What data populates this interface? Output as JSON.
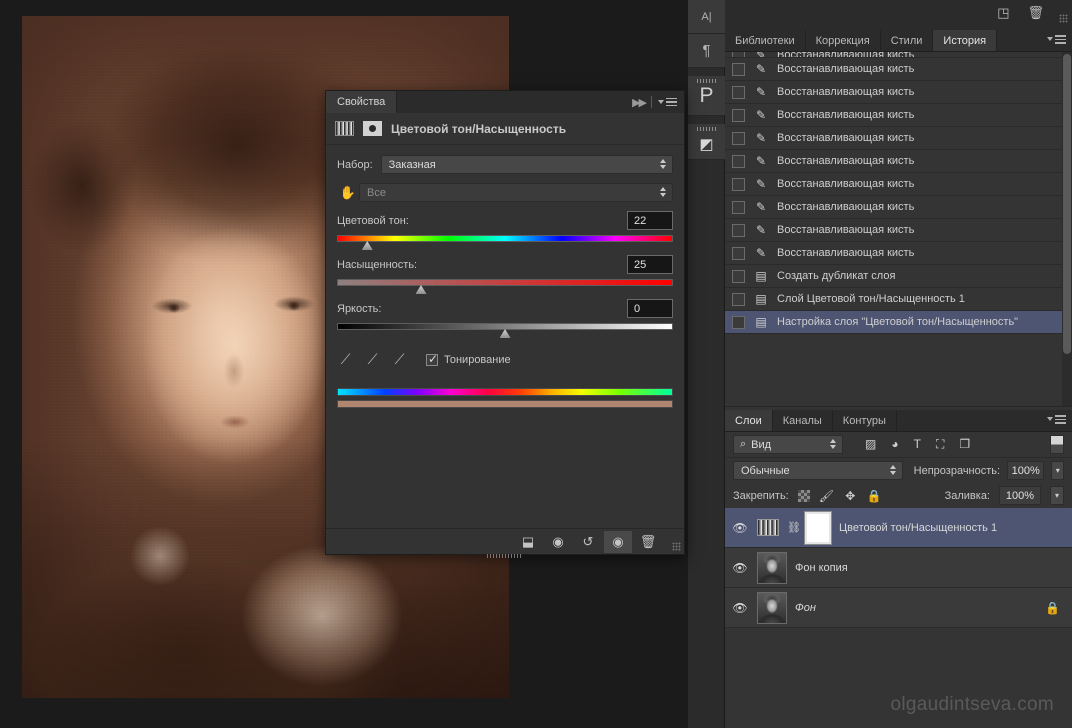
{
  "app": {
    "watermark": "olgaudintseva.com"
  },
  "tool_dock": {
    "items": [
      {
        "name": "character-panel-icon",
        "glyph": "A|"
      },
      {
        "name": "paragraph-panel-icon",
        "glyph": "¶"
      },
      {
        "name": "properties-panel-icon",
        "glyph": "P"
      },
      {
        "name": "adjustments-panel-icon",
        "glyph": "◩"
      }
    ]
  },
  "properties": {
    "tab_label": "Свойства",
    "title": "Цветовой тон/Насыщенность",
    "preset_label": "Набор:",
    "preset_value": "Заказная",
    "channel_value": "Все",
    "hue": {
      "label": "Цветовой тон:",
      "value": "22",
      "pos_pct": 9
    },
    "saturation": {
      "label": "Насыщенность:",
      "value": "25",
      "pos_pct": 25
    },
    "lightness": {
      "label": "Яркость:",
      "value": "0",
      "pos_pct": 50
    },
    "colorize_label": "Тонирование",
    "colorize_checked": true,
    "tint_color": "#b08670",
    "footer_icons": [
      {
        "name": "clip-to-layer-icon",
        "glyph": "⬓"
      },
      {
        "name": "view-previous-state-icon",
        "glyph": "◉"
      },
      {
        "name": "reset-icon",
        "glyph": "↺"
      },
      {
        "name": "toggle-visibility-icon",
        "glyph": "◉"
      },
      {
        "name": "delete-adjustment-icon",
        "glyph": "🗑"
      }
    ]
  },
  "right_dock": {
    "top_icons": [
      {
        "name": "new-item-icon",
        "glyph": "◳"
      },
      {
        "name": "delete-icon",
        "glyph": "🗑"
      }
    ],
    "tabs": [
      {
        "label": "Библиотеки",
        "active": false
      },
      {
        "label": "Коррекция",
        "active": false
      },
      {
        "label": "Стили",
        "active": false
      },
      {
        "label": "История",
        "active": true
      }
    ]
  },
  "history": {
    "rows": [
      {
        "label": "Восстанавливающая кисть",
        "icon": "healing-brush-icon",
        "glyph": "✎",
        "selected": false,
        "clipped": true
      },
      {
        "label": "Восстанавливающая кисть",
        "icon": "healing-brush-icon",
        "glyph": "✎",
        "selected": false
      },
      {
        "label": "Восстанавливающая кисть",
        "icon": "healing-brush-icon",
        "glyph": "✎",
        "selected": false
      },
      {
        "label": "Восстанавливающая кисть",
        "icon": "healing-brush-icon",
        "glyph": "✎",
        "selected": false
      },
      {
        "label": "Восстанавливающая кисть",
        "icon": "healing-brush-icon",
        "glyph": "✎",
        "selected": false
      },
      {
        "label": "Восстанавливающая кисть",
        "icon": "healing-brush-icon",
        "glyph": "✎",
        "selected": false
      },
      {
        "label": "Восстанавливающая кисть",
        "icon": "healing-brush-icon",
        "glyph": "✎",
        "selected": false
      },
      {
        "label": "Восстанавливающая кисть",
        "icon": "healing-brush-icon",
        "glyph": "✎",
        "selected": false
      },
      {
        "label": "Восстанавливающая кисть",
        "icon": "healing-brush-icon",
        "glyph": "✎",
        "selected": false
      },
      {
        "label": "Восстанавливающая кисть",
        "icon": "healing-brush-icon",
        "glyph": "✎",
        "selected": false
      },
      {
        "label": "Создать дубликат слоя",
        "icon": "document-icon",
        "glyph": "▤",
        "selected": false
      },
      {
        "label": "Слой Цветовой тон/Насыщенность 1",
        "icon": "document-icon",
        "glyph": "▤",
        "selected": false
      },
      {
        "label": "Настройка слоя \"Цветовой тон/Насыщенность\"",
        "icon": "document-icon",
        "glyph": "▤",
        "selected": true
      }
    ],
    "footer_icons": [
      {
        "name": "new-document-from-state-icon",
        "glyph": "⇥"
      },
      {
        "name": "new-snapshot-icon",
        "glyph": "▣"
      },
      {
        "name": "delete-state-icon",
        "glyph": "🗑"
      }
    ]
  },
  "layers": {
    "tabs": [
      {
        "label": "Слои",
        "active": true
      },
      {
        "label": "Каналы",
        "active": false
      },
      {
        "label": "Контуры",
        "active": false
      }
    ],
    "filter_value": "Вид",
    "filter_icons": [
      {
        "name": "filter-pixel-icon",
        "glyph": "▨"
      },
      {
        "name": "filter-adjustment-icon",
        "glyph": "◕"
      },
      {
        "name": "filter-type-icon",
        "glyph": "T"
      },
      {
        "name": "filter-shape-icon",
        "glyph": "⛶"
      },
      {
        "name": "filter-smart-object-icon",
        "glyph": "❐"
      }
    ],
    "blend_mode": "Обычные",
    "opacity_label": "Непрозрачность:",
    "opacity_value": "100%",
    "lock_label": "Закрепить:",
    "lock_icons": [
      {
        "name": "lock-transparency-icon",
        "glyph": ""
      },
      {
        "name": "lock-image-icon",
        "glyph": "🖌"
      },
      {
        "name": "lock-position-icon",
        "glyph": "✥"
      },
      {
        "name": "lock-all-icon",
        "glyph": "🔒"
      }
    ],
    "fill_label": "Заливка:",
    "fill_value": "100%",
    "rows": [
      {
        "name": "Цветовой тон/Насыщенность 1",
        "type": "adjustment",
        "selected": true,
        "locked": false,
        "italic": false
      },
      {
        "name": "Фон копия",
        "type": "pixel",
        "selected": false,
        "locked": false,
        "italic": false
      },
      {
        "name": "Фон",
        "type": "pixel",
        "selected": false,
        "locked": true,
        "italic": true
      }
    ]
  }
}
